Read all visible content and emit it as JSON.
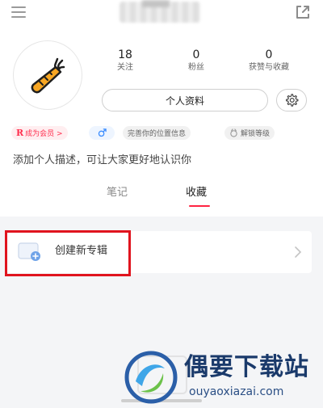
{
  "header": {
    "menu_icon": "menu-icon",
    "share_icon": "share-external-icon"
  },
  "avatar": {
    "icon": "carrot-icon"
  },
  "stats": [
    {
      "value": "18",
      "label": "关注"
    },
    {
      "value": "0",
      "label": "粉丝"
    },
    {
      "value": "0",
      "label": "获赞与收藏"
    }
  ],
  "profile_button_label": "个人资料",
  "settings_icon": "gear-icon",
  "tags": {
    "vip_mark": "R",
    "vip": "成为会员 >",
    "gender_icon": "male-icon",
    "location": "完善你的位置信息",
    "level": "解锁等级"
  },
  "description": "添加个人描述，可让大家更好地认识你",
  "tabs": {
    "notes": "笔记",
    "collect": "收藏",
    "active": "收藏"
  },
  "album": {
    "label": "创建新专辑",
    "icon": "add-album-icon"
  },
  "watermark": {
    "title": "偶要下载站",
    "url": "ouyaoxiazai.com"
  },
  "colors": {
    "accent": "#ff2442",
    "highlight_box": "#e0141e",
    "watermark": "#1a3a6b"
  }
}
